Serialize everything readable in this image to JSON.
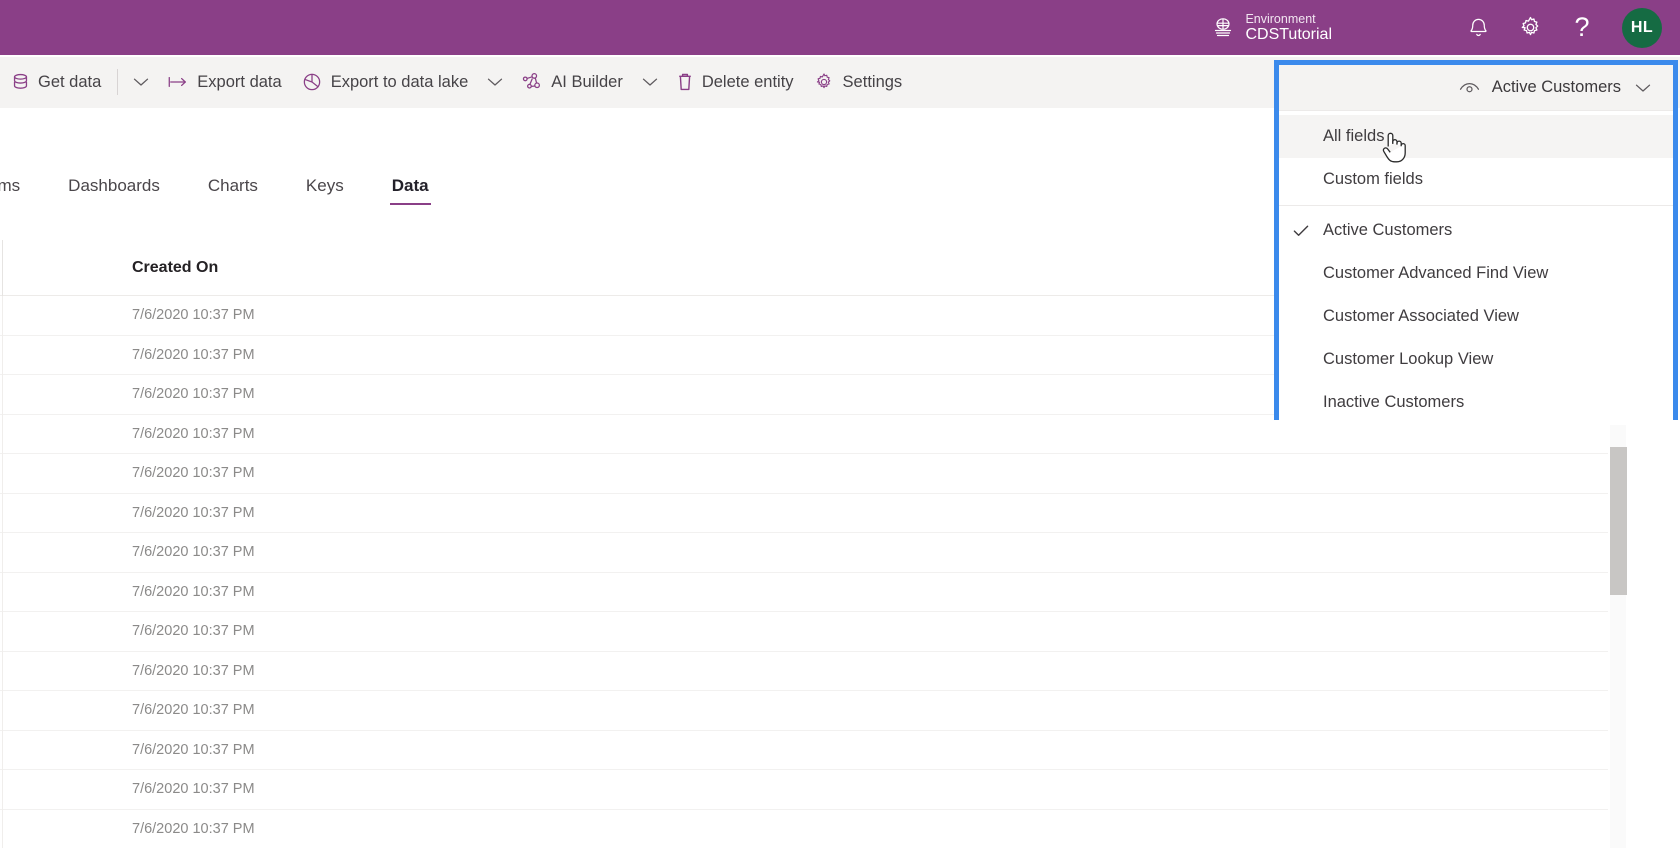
{
  "appbar": {
    "environment_label": "Environment",
    "environment_name": "CDSTutorial",
    "globe_icon": "environment-globe-icon",
    "notifications_icon": "bell-icon",
    "settings_icon": "gear-icon",
    "help_icon": "question-mark-icon",
    "avatar_initials": "HL",
    "accent_color": "#8a3f87",
    "avatar_color": "#156b43"
  },
  "toolbar": {
    "items": [
      {
        "label": "Get data",
        "icon": "database-icon",
        "has_caret": false
      },
      {
        "label": "",
        "icon": "chevron-down-icon",
        "has_caret": true
      },
      {
        "label": "Export data",
        "icon": "export-arrow-icon",
        "has_caret": false
      },
      {
        "label": "Export to data lake",
        "icon": "data-lake-icon",
        "has_caret": true
      },
      {
        "label": "AI Builder",
        "icon": "ai-builder-icon",
        "has_caret": true
      },
      {
        "label": "Delete entity",
        "icon": "trash-icon",
        "has_caret": false
      },
      {
        "label": "Settings",
        "icon": "gear-icon",
        "has_caret": false
      }
    ]
  },
  "tabs": [
    {
      "label": "Forms",
      "active": false
    },
    {
      "label": "Dashboards",
      "active": false
    },
    {
      "label": "Charts",
      "active": false
    },
    {
      "label": "Keys",
      "active": false
    },
    {
      "label": "Data",
      "active": true
    }
  ],
  "grid": {
    "columns": [
      "Created On"
    ],
    "rows": [
      {
        "created_on": "7/6/2020 10:37 PM"
      },
      {
        "created_on": "7/6/2020 10:37 PM"
      },
      {
        "created_on": "7/6/2020 10:37 PM"
      },
      {
        "created_on": "7/6/2020 10:37 PM"
      },
      {
        "created_on": "7/6/2020 10:37 PM"
      },
      {
        "created_on": "7/6/2020 10:37 PM"
      },
      {
        "created_on": "7/6/2020 10:37 PM"
      },
      {
        "created_on": "7/6/2020 10:37 PM"
      },
      {
        "created_on": "7/6/2020 10:37 PM"
      },
      {
        "created_on": "7/6/2020 10:37 PM"
      },
      {
        "created_on": "7/6/2020 10:37 PM"
      },
      {
        "created_on": "7/6/2020 10:37 PM"
      },
      {
        "created_on": "7/6/2020 10:37 PM"
      },
      {
        "created_on": "7/6/2020 10:37 PM"
      }
    ]
  },
  "view_selector": {
    "selected_label": "Active Customers",
    "eye_icon": "eye-view-icon",
    "caret_icon": "chevron-down-icon",
    "focus_border_color": "#3b8aec",
    "menu": [
      {
        "label": "All fields",
        "checked": false,
        "hovered": true
      },
      {
        "label": "Custom fields",
        "checked": false,
        "hovered": false
      },
      {
        "label": "Active Customers",
        "checked": true,
        "hovered": false
      },
      {
        "label": "Customer Advanced Find View",
        "checked": false,
        "hovered": false
      },
      {
        "label": "Customer Associated View",
        "checked": false,
        "hovered": false
      },
      {
        "label": "Customer Lookup View",
        "checked": false,
        "hovered": false
      },
      {
        "label": "Inactive Customers",
        "checked": false,
        "hovered": false
      }
    ]
  },
  "cursor": {
    "type": "pointing-hand"
  }
}
